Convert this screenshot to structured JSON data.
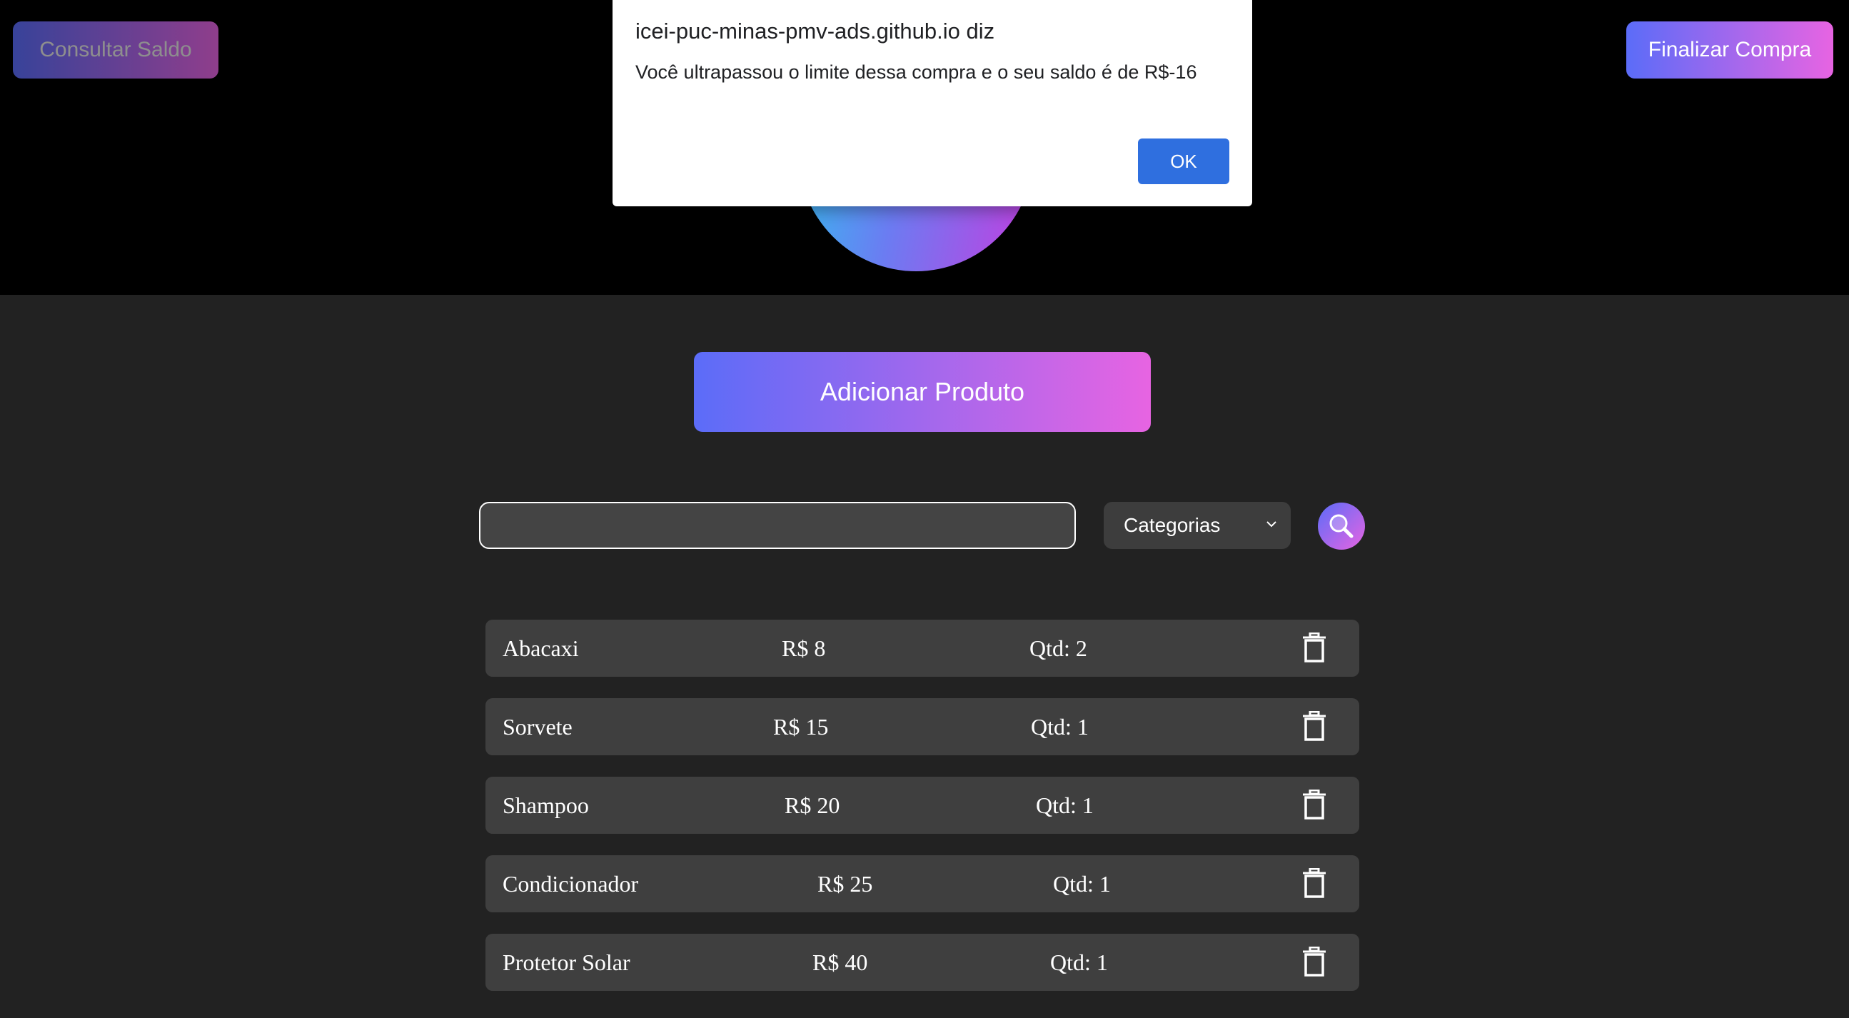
{
  "header": {
    "consultar_saldo_label": "Consultar Saldo",
    "finalizar_compra_label": "Finalizar Compra"
  },
  "main": {
    "add_product_label": "Adicionar Produto",
    "search": {
      "value": "",
      "placeholder": ""
    },
    "category_select": {
      "selected": "Categorias"
    },
    "search_button_icon": "magnifier-icon"
  },
  "products": [
    {
      "name": "Abacaxi",
      "price": "R$ 8",
      "qty": "Qtd: 2",
      "delete_icon": "trash-icon"
    },
    {
      "name": "Sorvete",
      "price": "R$ 15",
      "qty": "Qtd: 1",
      "delete_icon": "trash-icon"
    },
    {
      "name": "Shampoo",
      "price": "R$ 20",
      "qty": "Qtd: 1",
      "delete_icon": "trash-icon"
    },
    {
      "name": "Condicionador",
      "price": "R$ 25",
      "qty": "Qtd: 1",
      "delete_icon": "trash-icon"
    },
    {
      "name": "Protetor Solar",
      "price": "R$ 40",
      "qty": "Qtd: 1",
      "delete_icon": "trash-icon"
    }
  ],
  "alert_dialog": {
    "title": "icei-puc-minas-pmv-ads.github.io diz",
    "message": "Você ultrapassou o limite dessa compra e o seu saldo é de R$-16",
    "ok_label": "OK"
  },
  "colors": {
    "gradient_start": "#5b6cf8",
    "gradient_end": "#e764e2",
    "page_background": "#222222",
    "header_background": "#000000",
    "row_background": "#3f3f3f",
    "ok_button": "#2f6fdf"
  }
}
